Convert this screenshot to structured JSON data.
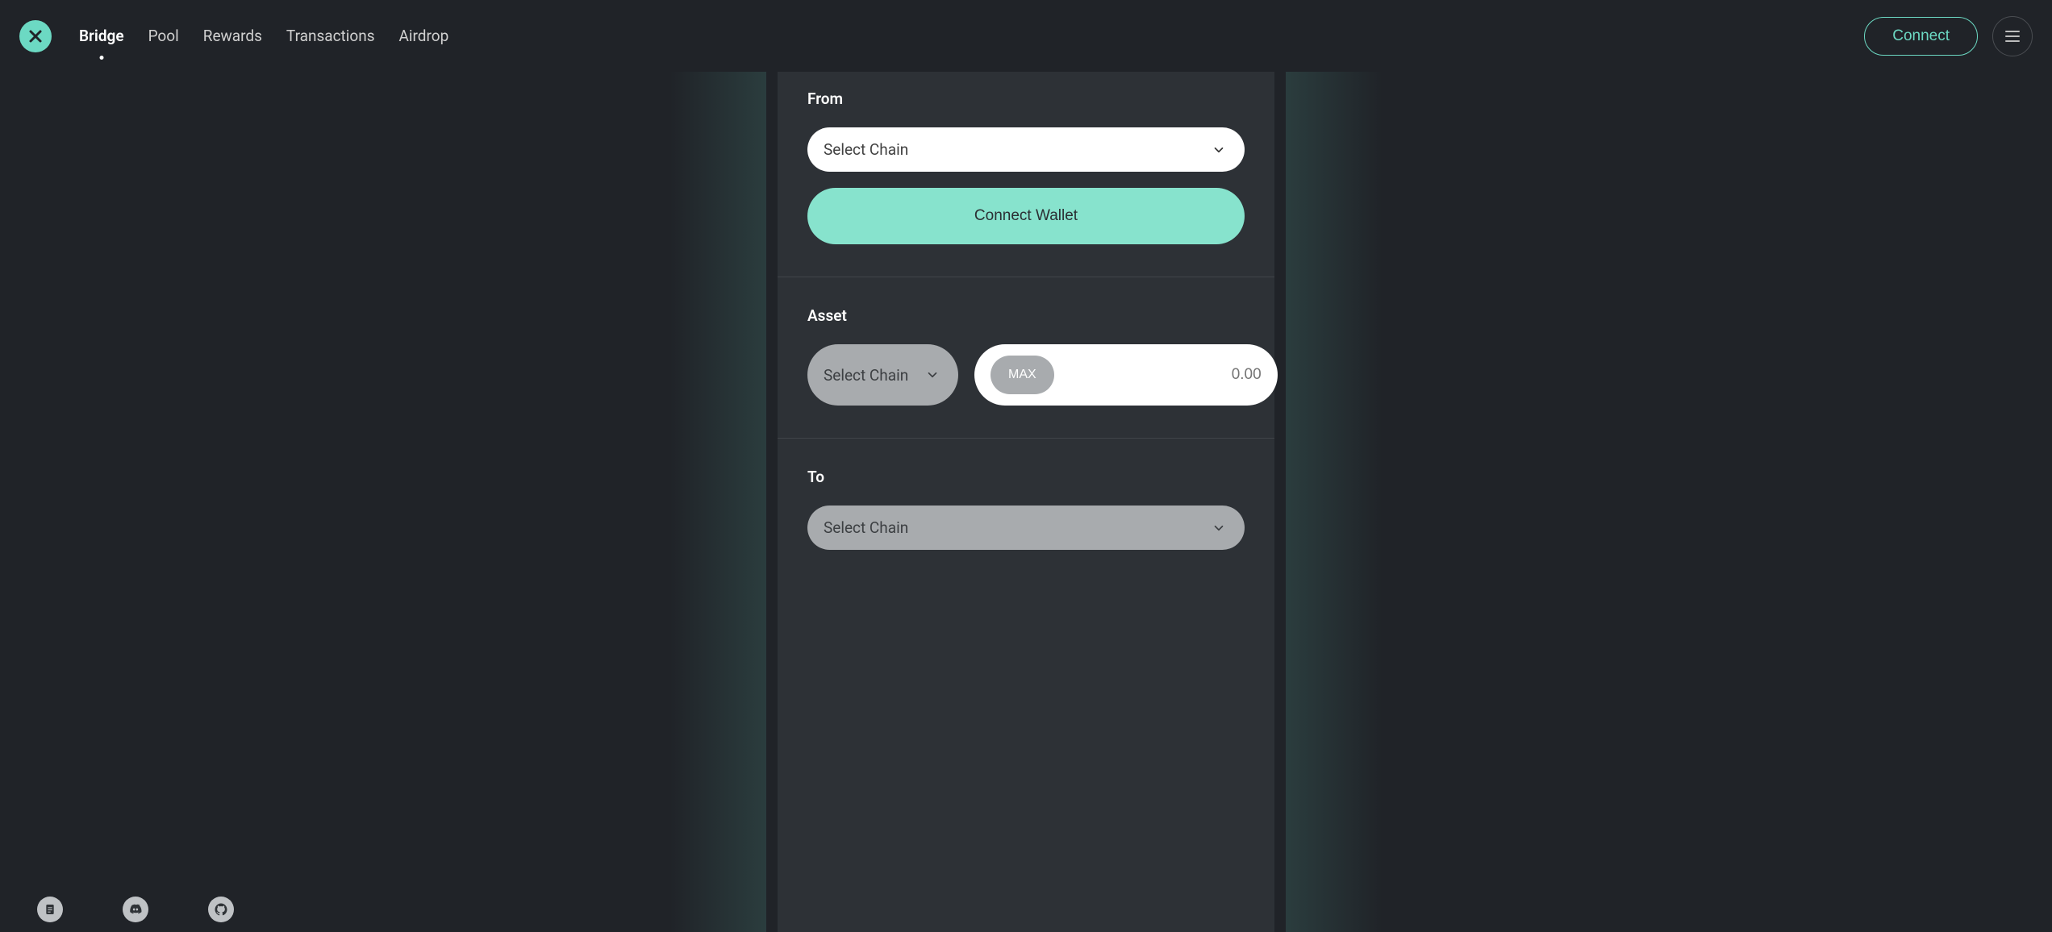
{
  "header": {
    "nav": [
      "Bridge",
      "Pool",
      "Rewards",
      "Transactions",
      "Airdrop"
    ],
    "active_index": 0,
    "connect": "Connect"
  },
  "panel": {
    "from": {
      "label": "From",
      "select_placeholder": "Select Chain",
      "connect_wallet": "Connect Wallet"
    },
    "asset": {
      "label": "Asset",
      "select_placeholder": "Select Chain",
      "max": "MAX",
      "amount_placeholder": "0.00"
    },
    "to": {
      "label": "To",
      "select_placeholder": "Select Chain"
    }
  },
  "colors": {
    "accent": "#6cd9c3",
    "accent_light": "#87e3cd",
    "bg": "#202328",
    "panel_bg": "#2d3136"
  }
}
